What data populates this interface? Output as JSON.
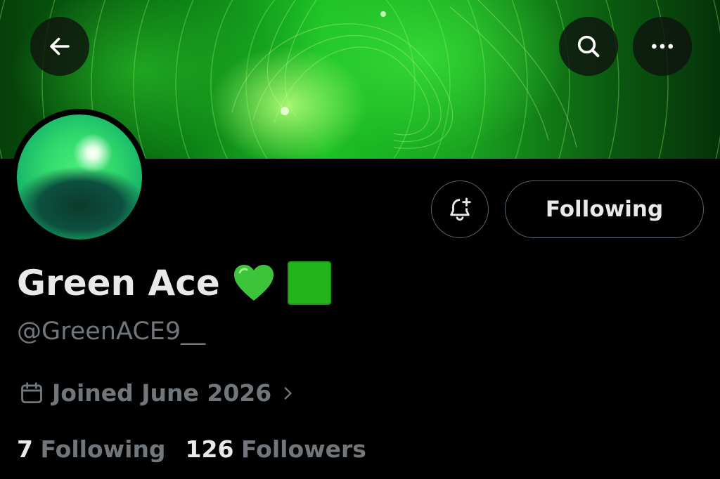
{
  "header": {
    "back_icon": "arrow-left-icon",
    "search_icon": "search-icon",
    "more_icon": "more-horizontal-icon"
  },
  "profile": {
    "display_name": "Green Ace",
    "emoji_heart": "💚",
    "emoji_square": "🟩",
    "handle": "@GreenACE9__",
    "joined": "Joined June 2026",
    "joined_icon": "calendar-icon",
    "notify_icon": "bell-plus-icon",
    "follow_button_label": "Following"
  },
  "stats": {
    "following_count": "7",
    "following_label": "Following",
    "followers_count": "126",
    "followers_label": "Followers"
  },
  "colors": {
    "background": "#000000",
    "text_primary": "#e7e9ea",
    "text_secondary": "#71767b",
    "border": "#536471",
    "accent_green": "#24b51c"
  }
}
